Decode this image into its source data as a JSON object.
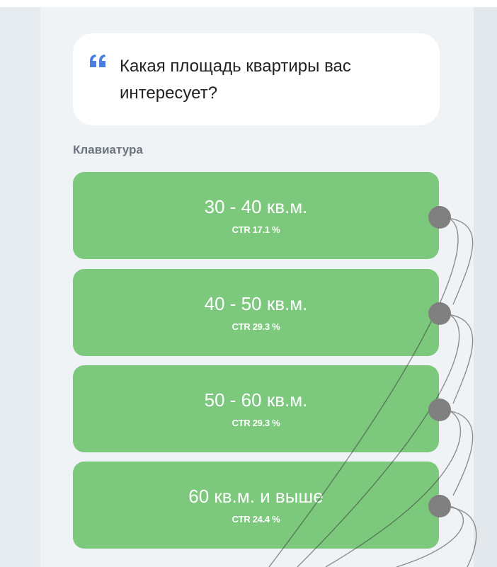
{
  "question": {
    "icon": "quote-icon",
    "text": "Какая площадь квартиры вас интересует?"
  },
  "keyboard": {
    "label": "Клавиатура",
    "buttons": [
      {
        "label": "30 - 40 кв.м.",
        "ctr": "CTR 17.1 %"
      },
      {
        "label": "40 - 50 кв.м.",
        "ctr": "CTR 29.3 %"
      },
      {
        "label": "50 - 60 кв.м.",
        "ctr": "CTR 29.3 %"
      },
      {
        "label": "60 кв.м. и выше",
        "ctr": "CTR 24.4 %"
      }
    ]
  },
  "colors": {
    "button_green": "#7cc97d",
    "accent_blue": "#4a7fe0",
    "connector_gray": "#808080"
  }
}
